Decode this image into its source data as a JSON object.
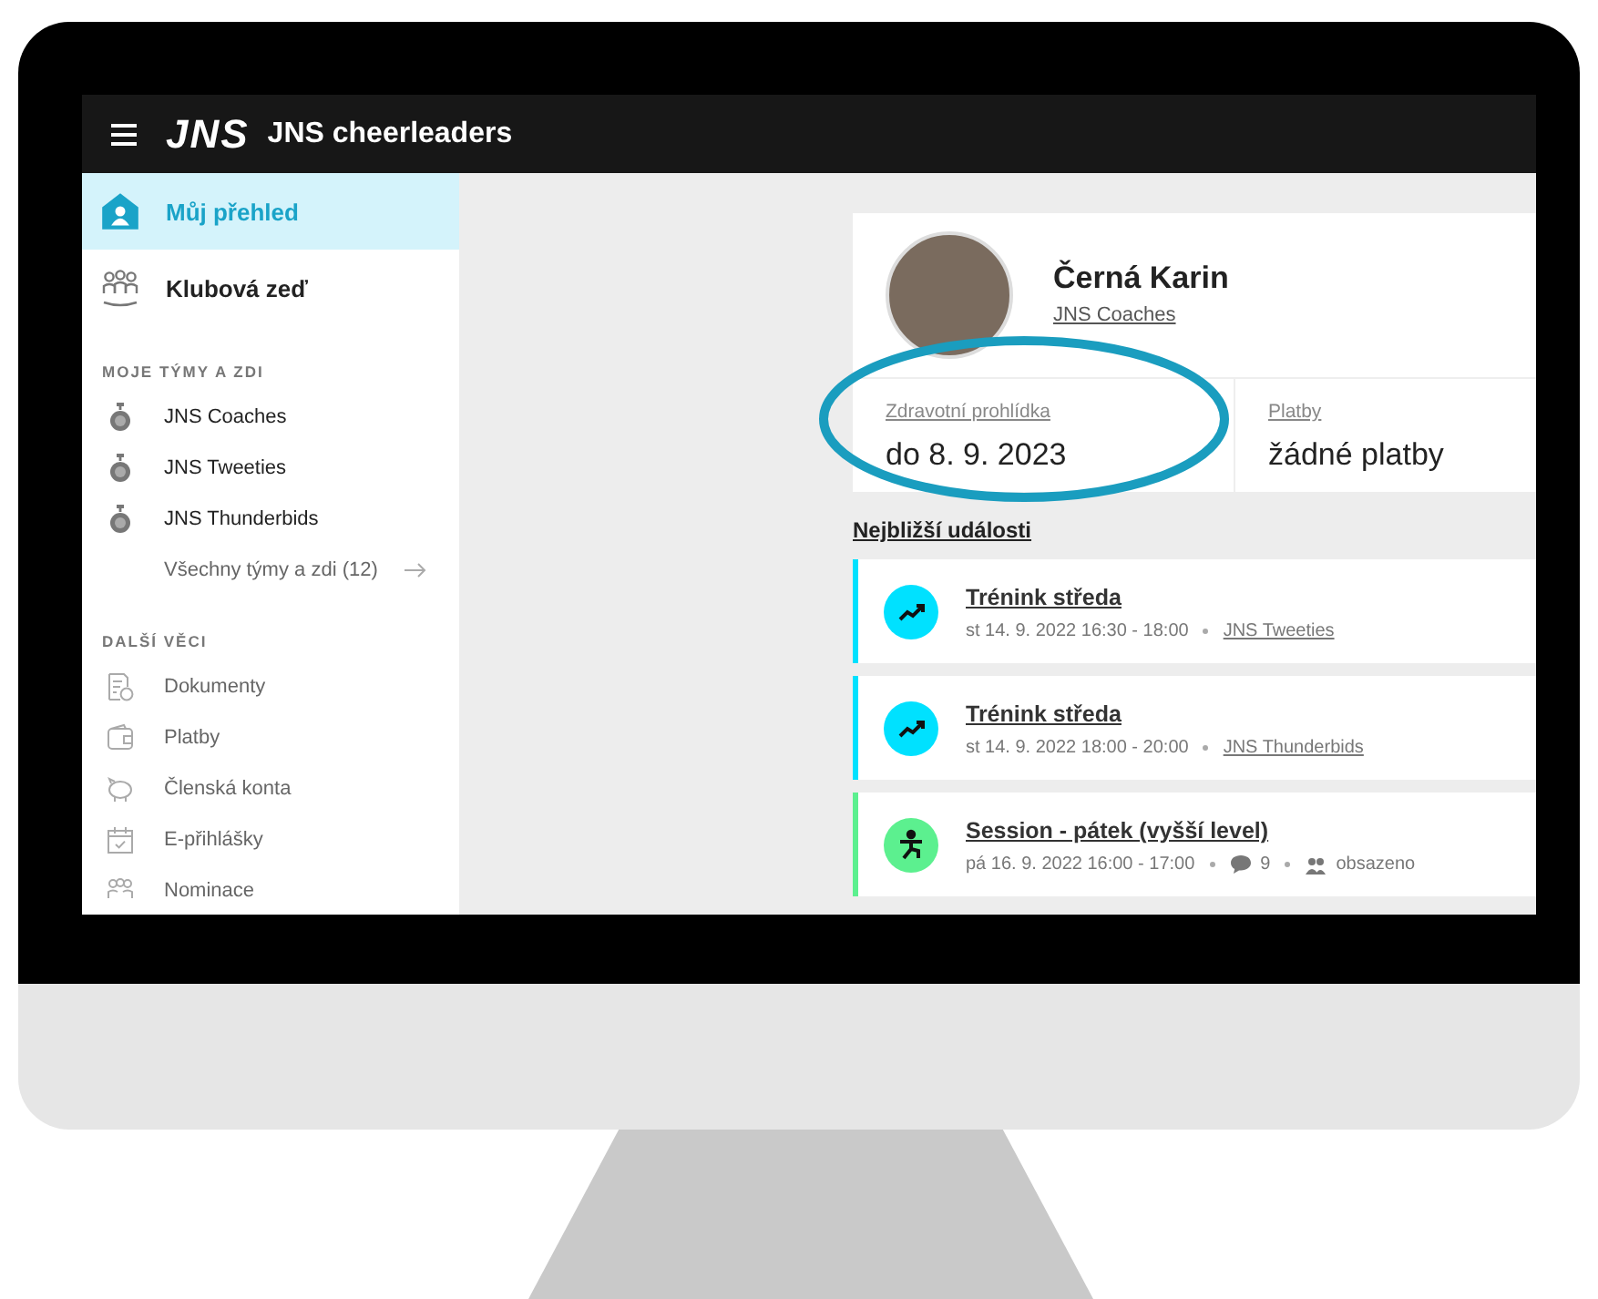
{
  "topbar": {
    "logo": "JNS",
    "title": "JNS cheerleaders"
  },
  "sidebar": {
    "main_items": [
      {
        "label": "Můj přehled",
        "selected": true,
        "kind": "home"
      },
      {
        "label": "Klubová zeď",
        "selected": false,
        "kind": "people"
      }
    ],
    "sections": [
      {
        "heading": "MOJE TÝMY A ZDI",
        "items": [
          {
            "label": "JNS Coaches",
            "kind": "team"
          },
          {
            "label": "JNS Tweeties",
            "kind": "team"
          },
          {
            "label": "JNS Thunderbids",
            "kind": "team"
          },
          {
            "label": "Všechny týmy a zdi (12)",
            "kind": "more"
          }
        ]
      },
      {
        "heading": "DALŠÍ VĚCI",
        "items": [
          {
            "label": "Dokumenty",
            "kind": "document"
          },
          {
            "label": "Platby",
            "kind": "wallet"
          },
          {
            "label": "Členská konta",
            "kind": "piggy"
          },
          {
            "label": "E-přihlášky",
            "kind": "calendar"
          },
          {
            "label": "Nominace",
            "kind": "group"
          }
        ]
      }
    ]
  },
  "profile": {
    "name": "Černá Karin",
    "team": "JNS Coaches",
    "stats": [
      {
        "label": "Zdravotní prohlídka",
        "value": "do 8. 9. 2023"
      },
      {
        "label": "Platby",
        "value": "žádné platby"
      }
    ]
  },
  "events_heading": "Nejbližší události",
  "events": [
    {
      "title": "Trénink středa",
      "kind": "trend",
      "color": "#00e1ff",
      "date": "st 14. 9. 2022 16:30 - 18:00",
      "team": "JNS Tweeties"
    },
    {
      "title": "Trénink středa",
      "kind": "trend",
      "color": "#00e1ff",
      "date": "st 14. 9. 2022 18:00 - 20:00",
      "team": "JNS Thunderbids"
    },
    {
      "title": "Session - pátek (vyšší level)",
      "kind": "exercise",
      "color": "#5cf08f",
      "date": "pá 16. 9. 2022 16:00 - 17:00",
      "comments": "9",
      "capacity": "obsazeno"
    }
  ]
}
